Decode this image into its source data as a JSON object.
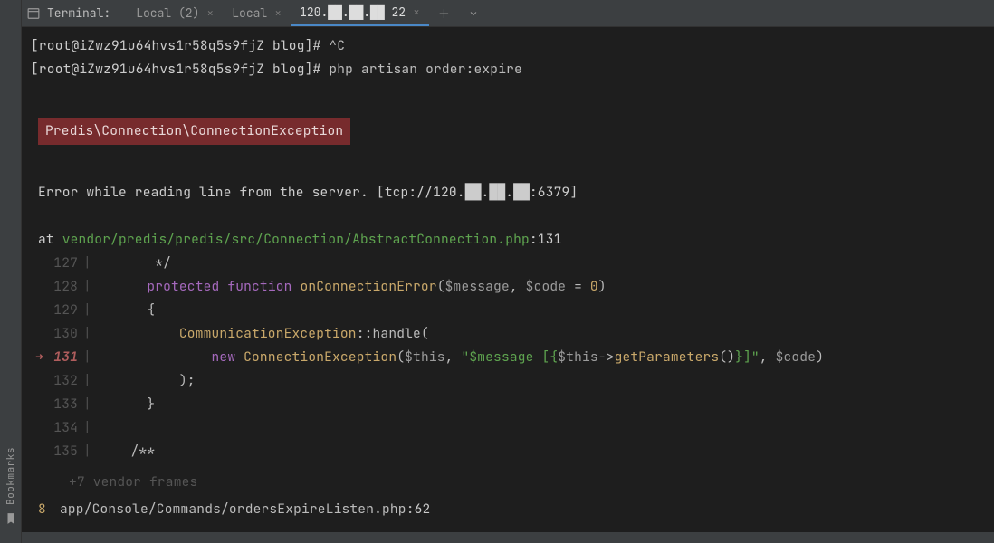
{
  "sidebar": {
    "vertical_label": "Bookmarks"
  },
  "header": {
    "title": "Terminal:",
    "tabs": [
      {
        "label": "Local (2)",
        "active": false
      },
      {
        "label": "Local",
        "active": false
      },
      {
        "label": "120.██.██.██ 22",
        "active": true
      }
    ]
  },
  "terminal": {
    "prompt1_host": "[root@iZwz91u64hvs1r58q5s9fjZ blog]# ",
    "prompt1_cmd": "^C",
    "prompt2_host": "[root@iZwz91u64hvs1r58q5s9fjZ blog]# ",
    "prompt2_cmd": "php artisan order:expire",
    "exception": "Predis\\Connection\\ConnectionException",
    "error_msg_a": "Error while reading line from the server. ",
    "error_msg_b": "[tcp://120.██.██.██:6379]",
    "at": "at ",
    "at_path": "vendor/predis/predis/src/Connection/AbstractConnection.php",
    "at_sep": ":",
    "at_line": "131",
    "code": {
      "127": {
        "text": "       */"
      },
      "128": {
        "kw1": "protected",
        "kw2": "function",
        "fn": "onConnectionError",
        "open": "(",
        "arg1": "$message",
        "comma1": ", ",
        "arg2": "$code",
        "eq": " = ",
        "zero": "0",
        "close": ")"
      },
      "129": {
        "brace": "{"
      },
      "130": {
        "cls": "CommunicationException",
        "sep": "::",
        "method": "handle",
        "open": "("
      },
      "131": {
        "new": "new",
        "cls": "ConnectionException",
        "open": "(",
        "this": "$this",
        "comma": ", ",
        "str_a": "\"$message [{",
        "expr_this": "$this",
        "arrow": "->",
        "call": "getParameters",
        "paren": "()",
        "str_b": "}]\"",
        "comma2": ", ",
        "code_var": "$code",
        "close": ")"
      },
      "132": {
        "close": ");"
      },
      "133": {
        "brace": "}"
      },
      "134": {
        "text": ""
      },
      "135": {
        "text": "    /**"
      }
    },
    "frames_more": "+7 vendor frames",
    "stack_idx": "8",
    "stack_path": "app/Console/Commands/ordersExpireListen.php",
    "stack_sep": ":",
    "stack_line": "62"
  }
}
